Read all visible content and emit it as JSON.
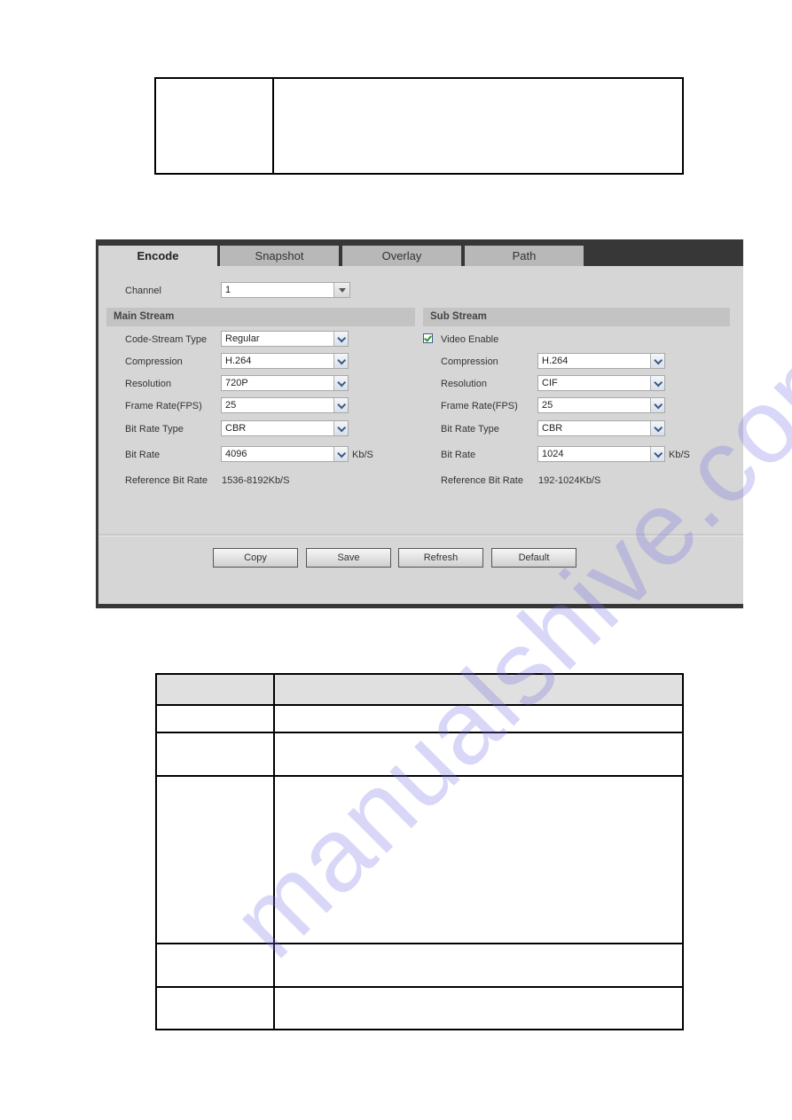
{
  "panel": {
    "tabs": [
      {
        "label": "Encode",
        "active": true
      },
      {
        "label": "Snapshot",
        "active": false
      },
      {
        "label": "Overlay",
        "active": false
      },
      {
        "label": "Path",
        "active": false
      }
    ],
    "channel": {
      "label": "Channel",
      "value": "1"
    },
    "main_stream": {
      "title": "Main Stream",
      "code_stream_type": {
        "label": "Code-Stream Type",
        "value": "Regular"
      },
      "compression": {
        "label": "Compression",
        "value": "H.264"
      },
      "resolution": {
        "label": "Resolution",
        "value": "720P"
      },
      "frame_rate": {
        "label": "Frame Rate(FPS)",
        "value": "25"
      },
      "bit_rate_type": {
        "label": "Bit Rate Type",
        "value": "CBR"
      },
      "bit_rate": {
        "label": "Bit Rate",
        "value": "4096",
        "unit": "Kb/S"
      },
      "reference_bit_rate": {
        "label": "Reference Bit Rate",
        "value": "1536-8192Kb/S"
      }
    },
    "sub_stream": {
      "title": "Sub Stream",
      "video_enable": {
        "label": "Video Enable",
        "checked": true
      },
      "compression": {
        "label": "Compression",
        "value": "H.264"
      },
      "resolution": {
        "label": "Resolution",
        "value": "CIF"
      },
      "frame_rate": {
        "label": "Frame Rate(FPS)",
        "value": "25"
      },
      "bit_rate_type": {
        "label": "Bit Rate Type",
        "value": "CBR"
      },
      "bit_rate": {
        "label": "Bit Rate",
        "value": "1024",
        "unit": "Kb/S"
      },
      "reference_bit_rate": {
        "label": "Reference Bit Rate",
        "value": "192-1024Kb/S"
      }
    },
    "buttons": {
      "copy": "Copy",
      "save": "Save",
      "refresh": "Refresh",
      "default": "Default"
    }
  },
  "watermark": "manualshive.com"
}
